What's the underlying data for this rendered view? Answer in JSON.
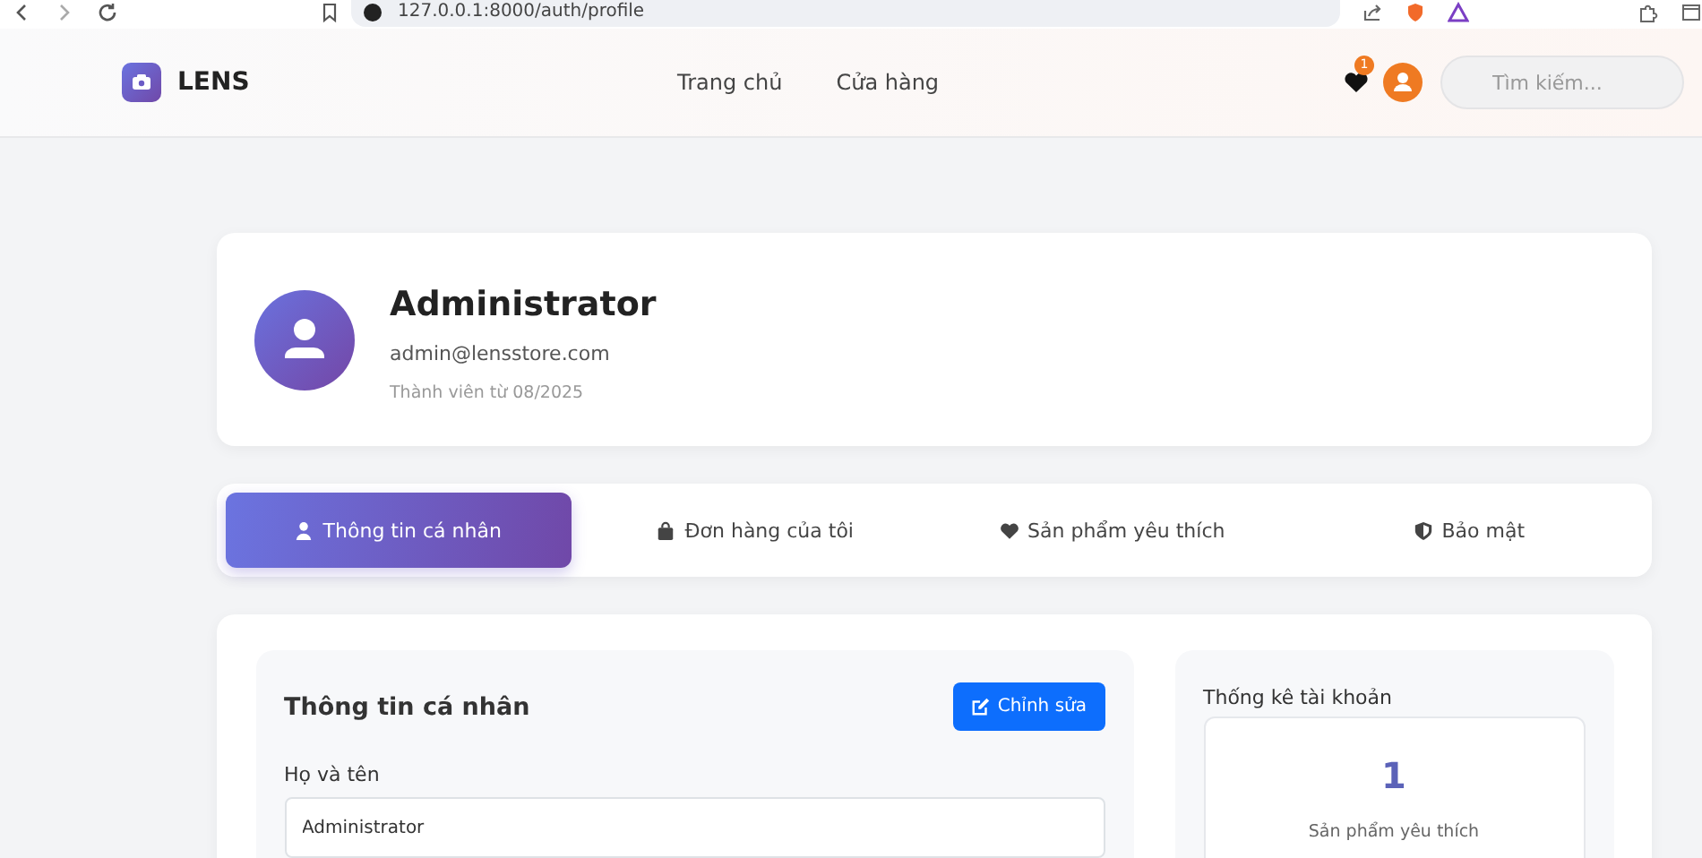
{
  "browser": {
    "url": "127.0.0.1:8000/auth/profile"
  },
  "nav": {
    "brand": "LENS",
    "links": [
      {
        "label": "Trang chủ",
        "selected": false
      },
      {
        "label": "Cửa hàng",
        "selected": false
      }
    ],
    "wishlist_count": "1",
    "search": {
      "placeholder": "Tìm kiếm..."
    }
  },
  "profile": {
    "name": "Administrator",
    "email": "admin@lensstore.com",
    "member_since": "Thành viên từ 08/2025"
  },
  "tabs": [
    {
      "label": "Thông tin cá nhân",
      "kind": "user",
      "selected": true
    },
    {
      "label": "Đơn hàng của tôi",
      "kind": "orders",
      "selected": false
    },
    {
      "label": "Sản phẩm yêu thích",
      "kind": "wishlist",
      "selected": false
    },
    {
      "label": "Bảo mật",
      "kind": "security",
      "selected": false
    }
  ],
  "personal_info": {
    "title": "Thông tin cá nhân",
    "edit_button": "Chỉnh sửa",
    "fields": [
      {
        "label": "Họ và tên",
        "value": "Administrator"
      }
    ]
  },
  "stats": {
    "title": "Thống kê tài khoản",
    "items": [
      {
        "value": "1",
        "label": "Sản phẩm yêu thích"
      }
    ]
  }
}
